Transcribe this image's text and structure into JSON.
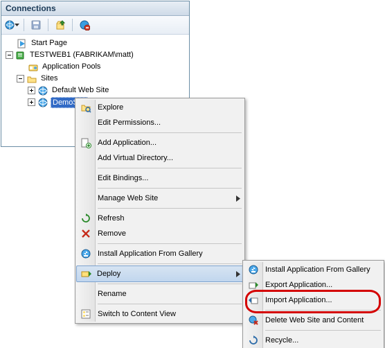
{
  "panel": {
    "title": "Connections"
  },
  "tree": {
    "start_page": "Start Page",
    "server": "TESTWEB1 (FABRIKAM\\matt)",
    "app_pools": "Application Pools",
    "sites": "Sites",
    "default_site": "Default Web Site",
    "demo_site": "DemoSite"
  },
  "context_menu": {
    "explore": "Explore",
    "edit_permissions": "Edit Permissions...",
    "add_application": "Add Application...",
    "add_virtual_directory": "Add Virtual Directory...",
    "edit_bindings": "Edit Bindings...",
    "manage_web_site": "Manage Web Site",
    "refresh": "Refresh",
    "remove": "Remove",
    "install_from_gallery": "Install Application From Gallery",
    "deploy": "Deploy",
    "rename": "Rename",
    "switch_content_view": "Switch to Content View"
  },
  "deploy_submenu": {
    "install_from_gallery": "Install Application From Gallery",
    "export_application": "Export Application...",
    "import_application": "Import Application...",
    "delete_site_content": "Delete Web Site and Content",
    "recycle": "Recycle..."
  },
  "icons": {
    "expand_plus": "+",
    "expand_minus": "-"
  },
  "colors": {
    "selection": "#316ac5",
    "callout": "#d40000",
    "panel_border": "#6b8ea5"
  }
}
